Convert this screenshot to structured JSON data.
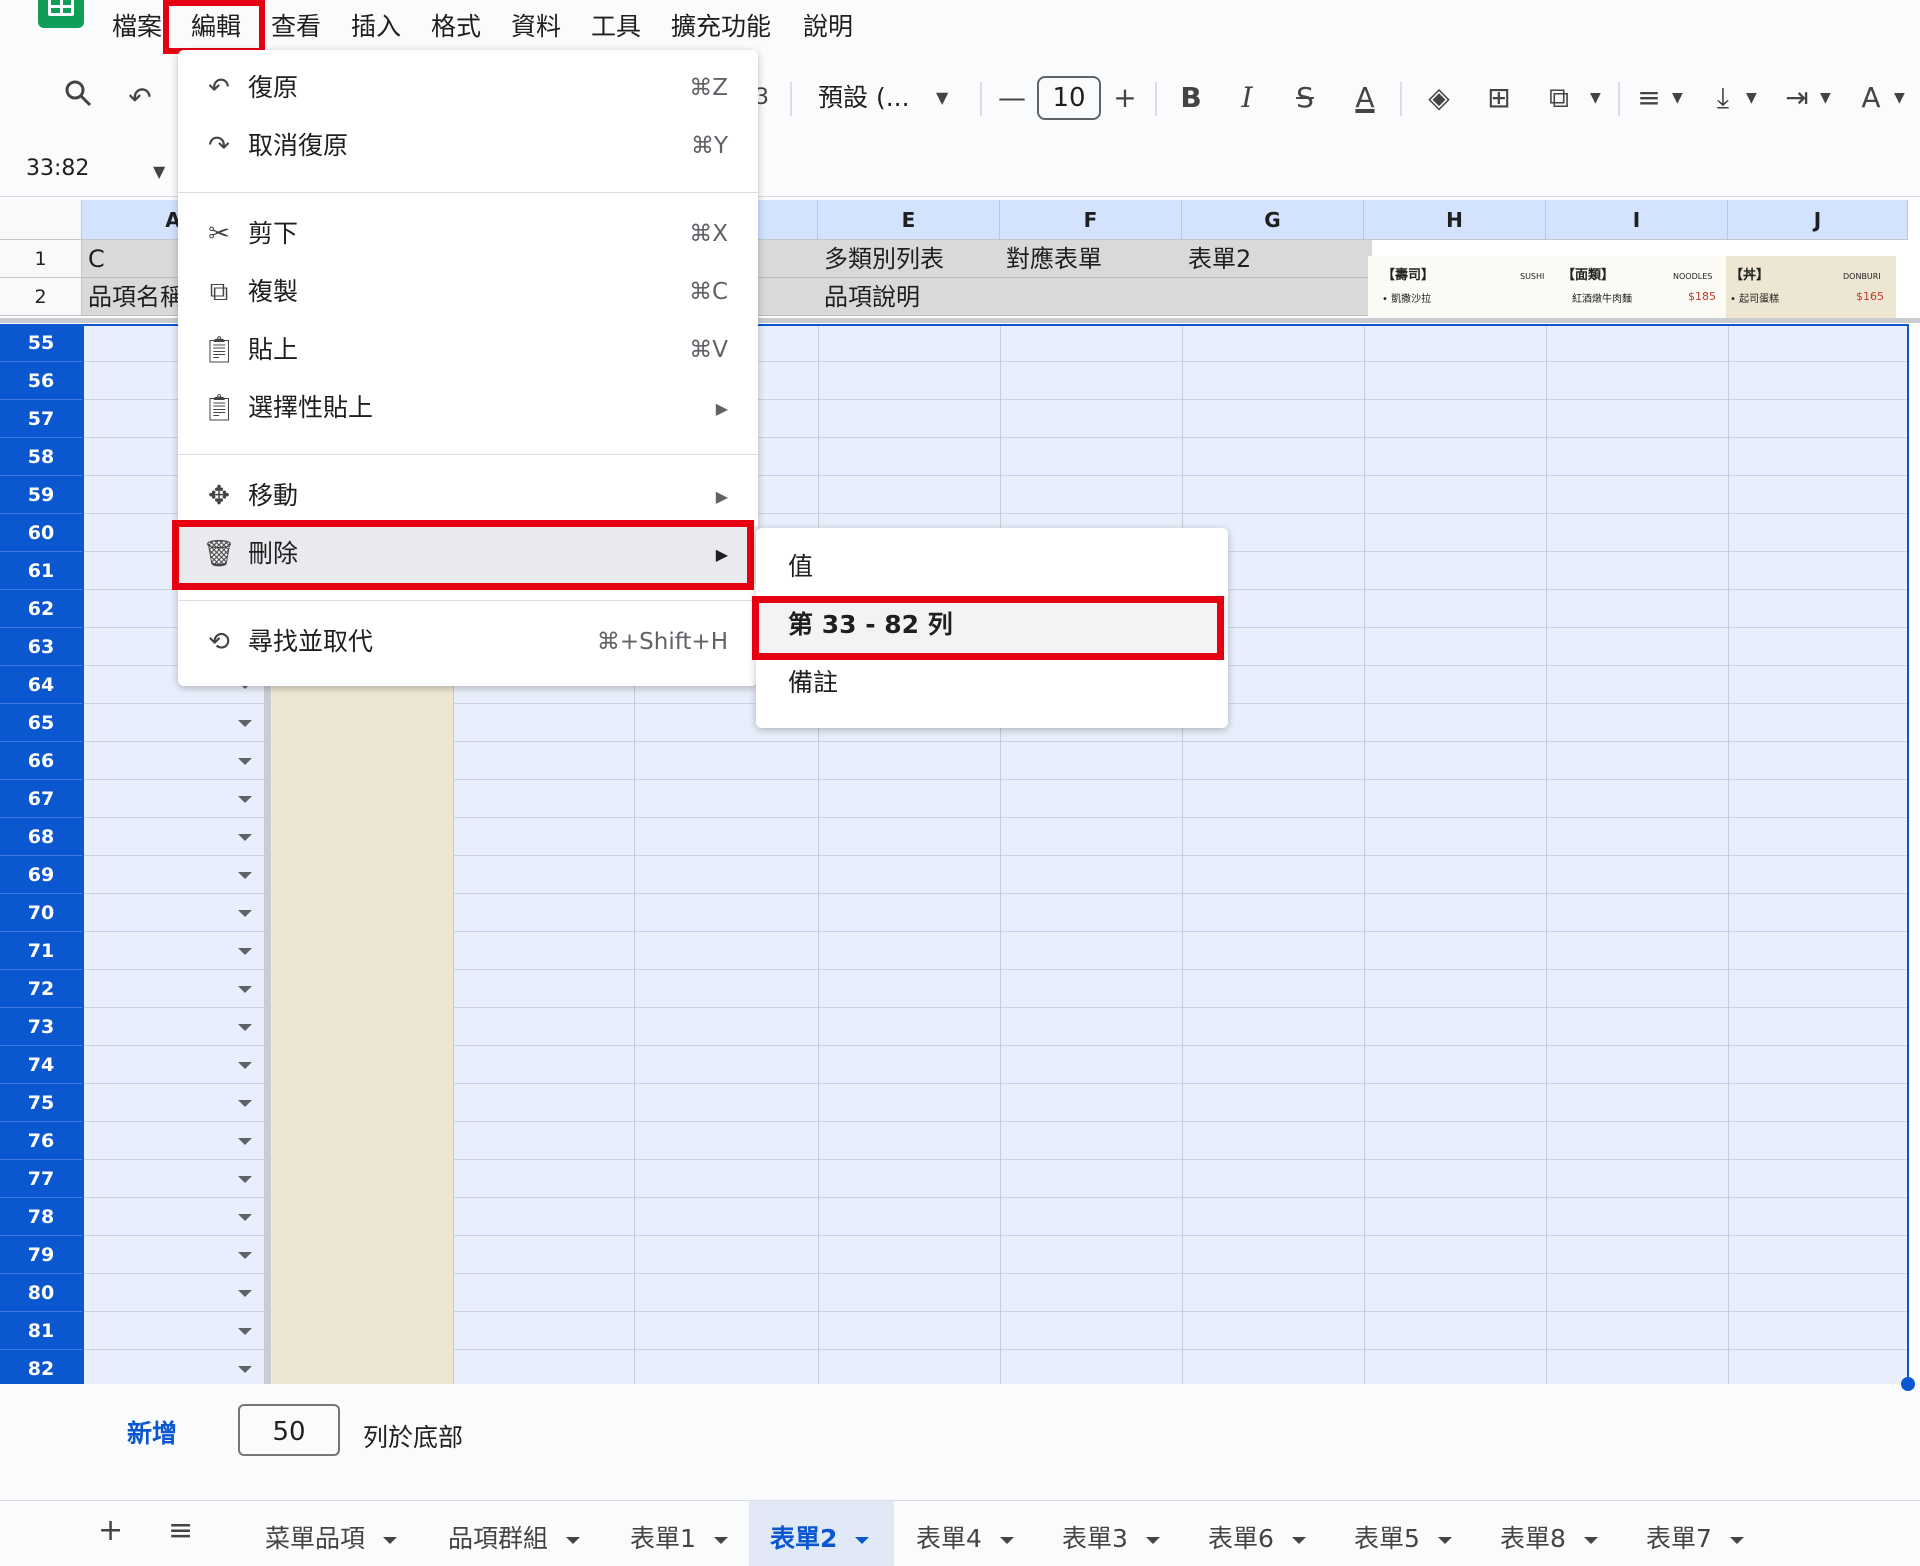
{
  "menubar": {
    "items": [
      "檔案",
      "編輯",
      "查看",
      "插入",
      "格式",
      "資料",
      "工具",
      "擴充功能",
      "說明"
    ]
  },
  "toolbar": {
    "font_name": "預設 (...",
    "font_size": "10",
    "partial_digit": "3",
    "bold": "B",
    "italic": "I",
    "minus": "—",
    "plus": "+"
  },
  "namebox": {
    "value": "33:82"
  },
  "columns": [
    "A",
    "E",
    "F",
    "G",
    "H",
    "I",
    "J"
  ],
  "frozen_rows": [
    {
      "num": "1",
      "a": "C",
      "e": "多類別列表",
      "f": "對應表單",
      "g": "表單2"
    },
    {
      "num": "2",
      "a": "品項名稱",
      "e": "品項說明",
      "f": "",
      "g": ""
    }
  ],
  "selected_rows": [
    "55",
    "56",
    "57",
    "58",
    "59",
    "60",
    "61",
    "62",
    "63",
    "64",
    "65",
    "66",
    "67",
    "68",
    "69",
    "70",
    "71",
    "72",
    "73",
    "74",
    "75",
    "76",
    "77",
    "78",
    "79",
    "80",
    "81",
    "82"
  ],
  "menu_image": {
    "sec1": "【壽司】",
    "sec1_en": "SUSHI",
    "sec1_item": "• 凱撒沙拉",
    "sec2": "【面類】",
    "sec2_en": "NOODLES",
    "sec2_item": "紅酒燉牛肉麵",
    "sec2_price": "$185",
    "sec3": "【丼】",
    "sec3_en": "DONBURI",
    "sec3_item": "• 起司蛋糕",
    "sec3_price": "$165"
  },
  "edit_menu": {
    "undo": {
      "label": "復原",
      "shortcut": "⌘Z"
    },
    "redo": {
      "label": "取消復原",
      "shortcut": "⌘Y"
    },
    "cut": {
      "label": "剪下",
      "shortcut": "⌘X"
    },
    "copy": {
      "label": "複製",
      "shortcut": "⌘C"
    },
    "paste": {
      "label": "貼上",
      "shortcut": "⌘V"
    },
    "paste_special": {
      "label": "選擇性貼上"
    },
    "move": {
      "label": "移動"
    },
    "delete": {
      "label": "刪除"
    },
    "find_replace": {
      "label": "尋找並取代",
      "shortcut": "⌘+Shift+H"
    }
  },
  "delete_submenu": {
    "values": "值",
    "rows": "第 33 - 82 列",
    "notes": "備註"
  },
  "add_rows": {
    "button": "新增",
    "count": "50",
    "label": "列於底部"
  },
  "tabs": [
    {
      "label": "菜單品項"
    },
    {
      "label": "品項群組"
    },
    {
      "label": "表單1"
    },
    {
      "label": "表單2",
      "active": true
    },
    {
      "label": "表單4"
    },
    {
      "label": "表單3"
    },
    {
      "label": "表單6"
    },
    {
      "label": "表單5"
    },
    {
      "label": "表單8"
    },
    {
      "label": "表單7"
    }
  ],
  "colors": {
    "accent": "#0b57d0",
    "highlight": "#e60012",
    "brand": "#0f9d58"
  }
}
